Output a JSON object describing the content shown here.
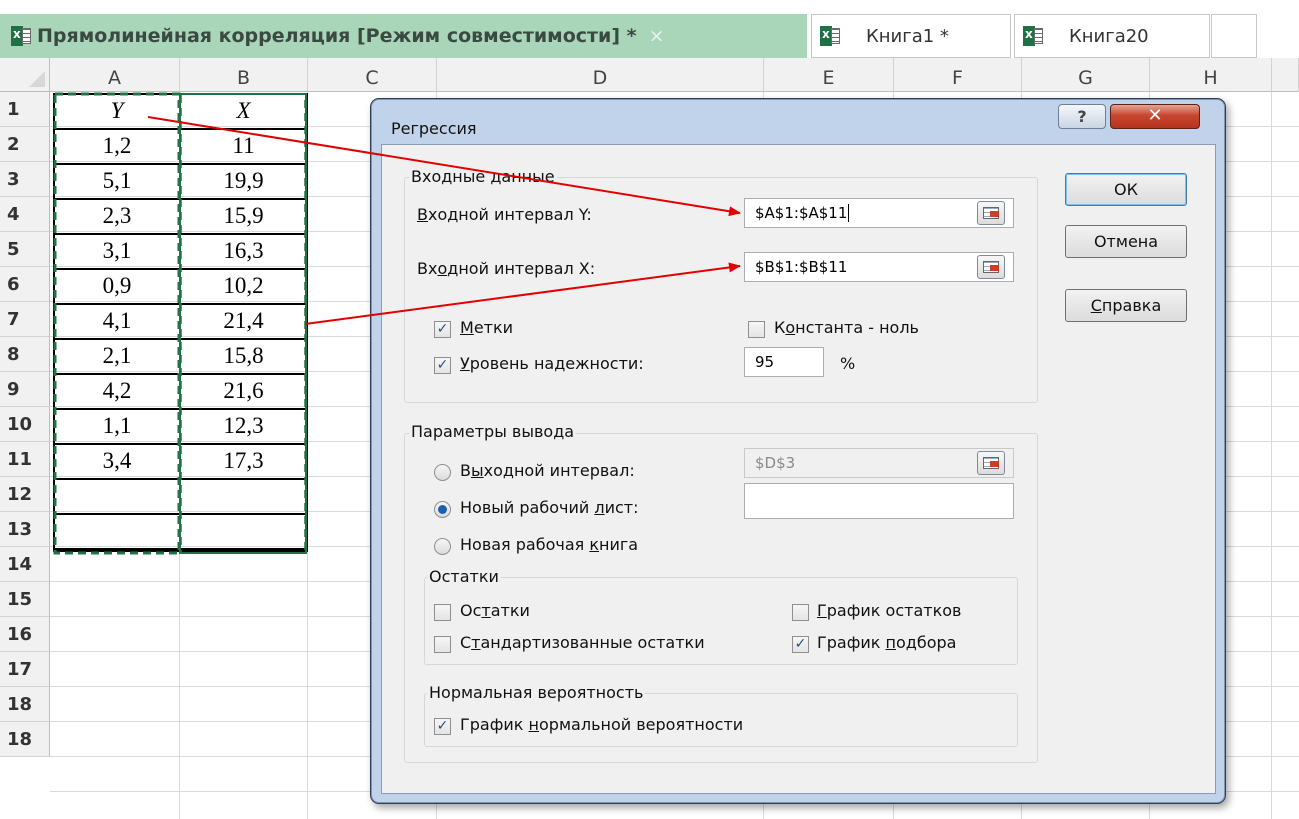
{
  "tabs": {
    "active": {
      "title": "Прямолинейная корреляция  [Режим совместимости] *",
      "close": "×"
    },
    "others": [
      {
        "label": "Книга1 *"
      },
      {
        "label": "Книга20"
      }
    ]
  },
  "sheet": {
    "columns": [
      "A",
      "B",
      "C",
      "D",
      "E",
      "F",
      "G",
      "H"
    ],
    "rows": [
      "1",
      "2",
      "3",
      "4",
      "5",
      "6",
      "7",
      "8",
      "9",
      "10",
      "11",
      "12",
      "13",
      "14",
      "15",
      "16",
      "17",
      "18"
    ],
    "table": {
      "header": {
        "a": "Y",
        "b": "X"
      },
      "data": [
        {
          "a": "1,2",
          "b": "11"
        },
        {
          "a": "5,1",
          "b": "19,9"
        },
        {
          "a": "2,3",
          "b": "15,9"
        },
        {
          "a": "3,1",
          "b": "16,3"
        },
        {
          "a": "0,9",
          "b": "10,2"
        },
        {
          "a": "4,1",
          "b": "21,4"
        },
        {
          "a": "2,1",
          "b": "15,8"
        },
        {
          "a": "4,2",
          "b": "21,6"
        },
        {
          "a": "1,1",
          "b": "12,3"
        },
        {
          "a": "3,4",
          "b": "17,3"
        }
      ]
    }
  },
  "dialog": {
    "title": "Регрессия",
    "help": "?",
    "close": "✕",
    "input": {
      "group": "Входные данные",
      "y_label_u": "В",
      "y_label_rest": "ходной интервал Y:",
      "y_value": "$A$1:$A$11",
      "x_label_pre": "Вх",
      "x_label_u": "о",
      "x_label_rest": "дной интервал X:",
      "x_value": "$B$1:$B$11",
      "labels_u": "М",
      "labels_rest": "етки",
      "labels_checked": true,
      "const_pre": "К",
      "const_u": "о",
      "const_rest": "нстанта - ноль",
      "const_checked": false,
      "conf_u": "У",
      "conf_rest": "ровень надежности:",
      "conf_checked": true,
      "conf_value": "95",
      "conf_unit": "%"
    },
    "output": {
      "group": "Параметры вывода",
      "range_pre": "В",
      "range_u": "ы",
      "range_rest": "ходной интервал:",
      "range_value": "$D$3",
      "sheet_pre": "Новый рабочий ",
      "sheet_u": "л",
      "sheet_rest": "ист:",
      "sheet_value": "",
      "book_pre": "Новая рабочая ",
      "book_u": "к",
      "book_rest": "нига",
      "selected": "new_sheet"
    },
    "residuals": {
      "group": "Остатки",
      "res_pre": "Ос",
      "res_u": "т",
      "res_rest": "атки",
      "res_checked": false,
      "std_pre": "С",
      "std_u": "т",
      "std_rest": "андартизованные остатки",
      "std_checked": false,
      "plot_u": "Г",
      "plot_rest": "рафик остатков",
      "plot_checked": false,
      "fit_pre": "График ",
      "fit_u": "п",
      "fit_rest": "одбора",
      "fit_checked": true
    },
    "normal": {
      "group": "Нормальная вероятность",
      "plot_pre": "График ",
      "plot_u": "н",
      "plot_rest": "ормальной вероятности",
      "plot_checked": true
    },
    "buttons": {
      "ok": "ОК",
      "cancel": "Отмена",
      "help_u": "С",
      "help_rest": "правка"
    }
  },
  "colors": {
    "tab_active": "#a9d5b9",
    "excel_green": "#1e7145",
    "arrow": "#e00000",
    "selection": "#217346"
  },
  "icons": [
    "excel-workbook-icon",
    "range-select-icon",
    "help-icon",
    "close-icon"
  ]
}
